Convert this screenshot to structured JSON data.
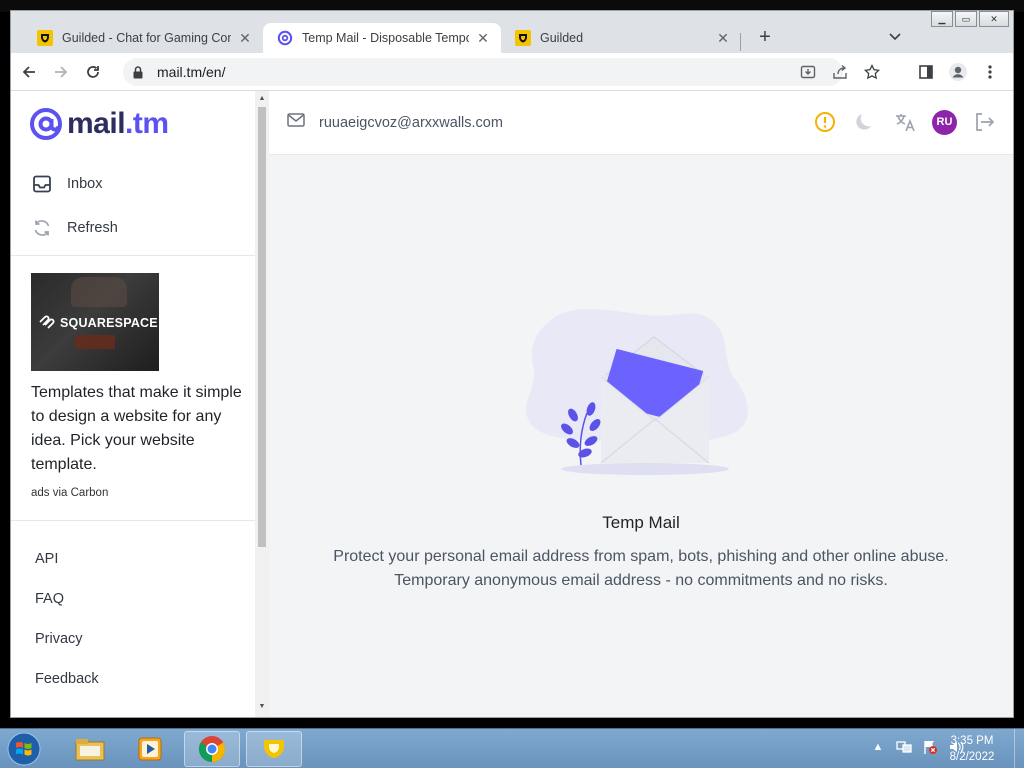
{
  "browser": {
    "tabs": [
      {
        "title": "Guilded - Chat for Gaming Comm",
        "favicon": "guilded-icon",
        "active": false
      },
      {
        "title": "Temp Mail - Disposable Tempora",
        "favicon": "mailtm-icon",
        "active": true
      },
      {
        "title": "Guilded",
        "favicon": "guilded-icon",
        "active": false
      }
    ],
    "new_tab_symbol": "+",
    "url": "mail.tm/en/"
  },
  "sidebar": {
    "logo_prefix": "mail",
    "logo_suffix": ".tm",
    "nav": [
      {
        "label": "Inbox",
        "icon": "inbox-icon"
      },
      {
        "label": "Refresh",
        "icon": "refresh-icon"
      }
    ],
    "ad": {
      "brand": "SQUARESPACE",
      "text": "Templates that make it simple to design a website for any idea. Pick your website template.",
      "via": "ads via Carbon"
    },
    "footer_links": [
      "API",
      "FAQ",
      "Privacy",
      "Feedback"
    ]
  },
  "main": {
    "email": "ruuaeigcvoz@arxxwalls.com",
    "avatar_initials": "RU",
    "empty_title": "Temp Mail",
    "empty_desc_line1": "Protect your personal email address from spam, bots, phishing and other online abuse.",
    "empty_desc_line2": "Temporary anonymous email address - no commitments and no risks."
  },
  "taskbar": {
    "time": "3:35 PM",
    "date": "8/2/2022"
  },
  "colors": {
    "accent": "#5b52f0",
    "logo_dark": "#2d2e5f",
    "warning": "#f5b301",
    "avatar": "#8e24aa"
  }
}
